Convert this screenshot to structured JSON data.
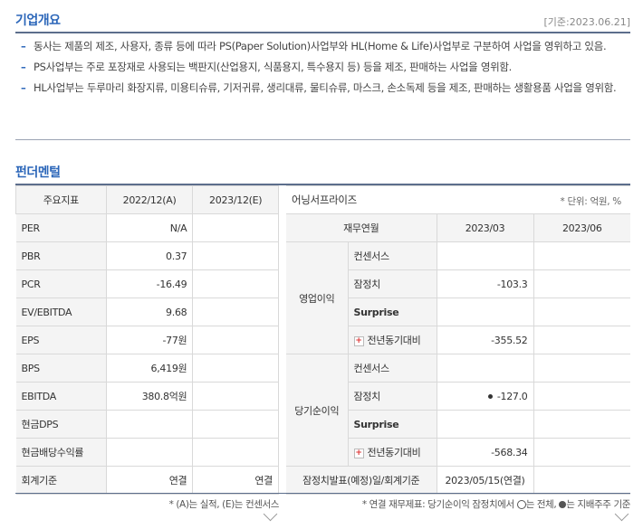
{
  "overview": {
    "title": "기업개요",
    "as_of": "[기준:2023.06.21]",
    "bullets": [
      "동사는 제품의 제조, 사용자, 종류 등에 따라 PS(Paper Solution)사업부와 HL(Home & Life)사업부로 구분하여 사업을 영위하고 있음.",
      "PS사업부는 주로 포장재로 사용되는 백판지(산업용지, 식품용지, 특수용지 등) 등을 제조, 판매하는 사업을 영위함.",
      "HL사업부는 두루마리 화장지류, 미용티슈류, 기저귀류, 생리대류, 물티슈류, 마스크, 손소독제 등을 제조, 판매하는 생활용품 사업을 영위함."
    ]
  },
  "fundamentals": {
    "title": "펀더멘털",
    "headers": [
      "주요지표",
      "2022/12(A)",
      "2023/12(E)"
    ],
    "rows": [
      {
        "label": "PER",
        "a": "N/A",
        "e": ""
      },
      {
        "label": "PBR",
        "a": "0.37",
        "e": ""
      },
      {
        "label": "PCR",
        "a": "-16.49",
        "e": ""
      },
      {
        "label": "EV/EBITDA",
        "a": "9.68",
        "e": ""
      },
      {
        "label": "EPS",
        "a": "-77원",
        "e": ""
      },
      {
        "label": "BPS",
        "a": "6,419원",
        "e": ""
      },
      {
        "label": "EBITDA",
        "a": "380.8억원",
        "e": ""
      },
      {
        "label": "현금DPS",
        "a": "",
        "e": ""
      },
      {
        "label": "현금배당수익률",
        "a": "",
        "e": ""
      },
      {
        "label": "회계기준",
        "a": "연결",
        "e": "연결"
      }
    ],
    "footnote": "* (A)는 실적, (E)는 컨센서스"
  },
  "earnings": {
    "title": "어닝서프라이즈",
    "unit": "* 단위: 억원, %",
    "col_header": "재무연월",
    "periods": [
      "2023/03",
      "2023/06"
    ],
    "groups": [
      {
        "name": "영업이익",
        "rows": [
          {
            "label": "컨센서스",
            "v1": "",
            "v2": ""
          },
          {
            "label": "잠정치",
            "v1": "-103.3",
            "v2": ""
          },
          {
            "label": "Surprise",
            "v1": "",
            "v2": ""
          },
          {
            "label": "전년동기대비",
            "v1": "-355.52",
            "v2": ""
          }
        ]
      },
      {
        "name": "당기순이익",
        "rows": [
          {
            "label": "컨센서스",
            "v1": "",
            "v2": ""
          },
          {
            "label": "잠정치",
            "v1": "-127.0",
            "v2": ""
          },
          {
            "label": "Surprise",
            "v1": "",
            "v2": ""
          },
          {
            "label": "전년동기대비",
            "v1": "-568.34",
            "v2": ""
          }
        ]
      }
    ],
    "announce_label": "잠정치발표(예정)일/회계기준",
    "announce_value": "2023/05/15(연결)",
    "footnote_prefix": "* 연결 재무제표: 당기순이익 잠정치에서",
    "footnote_o": "는 전체,",
    "footnote_b": "는 지배주주 기준"
  }
}
